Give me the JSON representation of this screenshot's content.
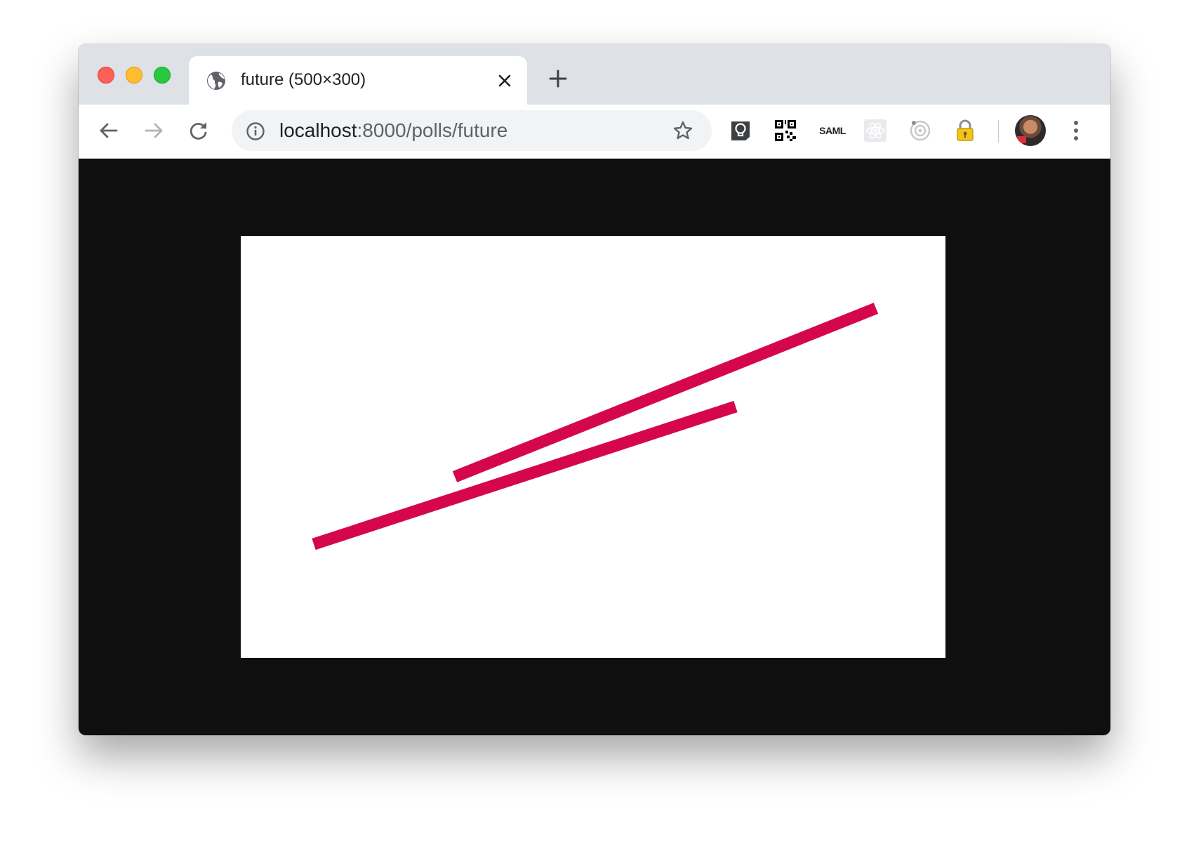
{
  "browser": {
    "tab": {
      "title": "future (500×300)",
      "icon": "globe-icon"
    },
    "new_tab_icon": "plus-icon",
    "toolbar": {
      "back_icon": "arrow-left-icon",
      "forward_icon": "arrow-right-icon",
      "reload_icon": "reload-icon"
    },
    "address_bar": {
      "host": "localhost",
      "rest": ":8000/polls/future",
      "info_icon": "info-icon",
      "bookmark_icon": "star-icon"
    },
    "extensions": [
      {
        "name": "bulb-extension-icon"
      },
      {
        "name": "qr-code-extension-icon"
      },
      {
        "name": "saml-extension-icon",
        "label": "SAML"
      },
      {
        "name": "react-extension-icon"
      },
      {
        "name": "target-extension-icon"
      },
      {
        "name": "lock-extension-icon"
      }
    ],
    "menu_icon": "kebab-menu-icon"
  },
  "page": {
    "background": "#0f0f0f",
    "canvas_background": "#ffffff",
    "line_color": "#d6064e"
  }
}
